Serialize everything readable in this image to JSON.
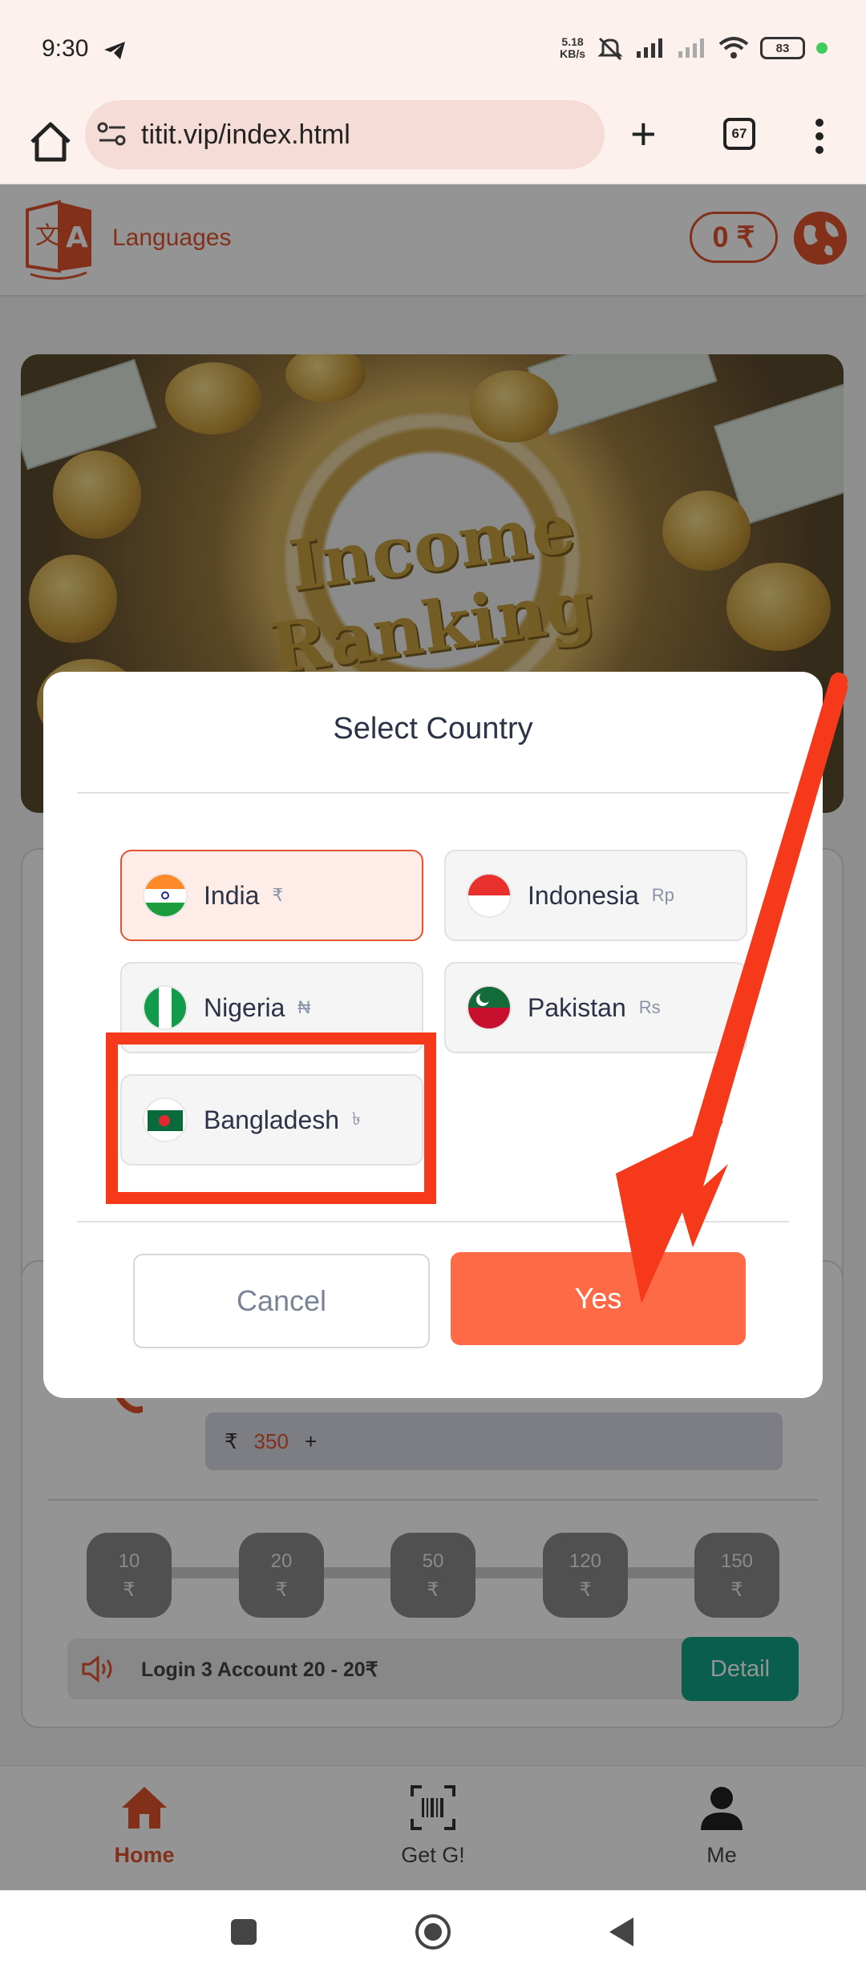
{
  "status_bar": {
    "time": "9:30",
    "net_speed_value": "5.18",
    "net_speed_unit": "KB/s",
    "battery": "83"
  },
  "browser": {
    "url": "titit.vip/index.html",
    "tab_count": "67"
  },
  "header": {
    "languages_label": "Languages",
    "balance": "0 ₹"
  },
  "banner": {
    "line1": "Income",
    "line2": "Ranking"
  },
  "background": {
    "amount_currency": "₹",
    "amount_value": "350",
    "amount_plus": "+",
    "reward_chips": [
      {
        "value": "10",
        "currency": "₹"
      },
      {
        "value": "20",
        "currency": "₹"
      },
      {
        "value": "50",
        "currency": "₹"
      },
      {
        "value": "120",
        "currency": "₹"
      },
      {
        "value": "150",
        "currency": "₹"
      }
    ],
    "notice_text": "Login 3 Account 20 - 20₹",
    "detail_label": "Detail"
  },
  "bottom_nav": {
    "home": "Home",
    "get": "Get G!",
    "me": "Me"
  },
  "dialog": {
    "title": "Select Country",
    "countries": [
      {
        "name": "India",
        "symbol": "₹",
        "selected": true
      },
      {
        "name": "Indonesia",
        "symbol": "Rp"
      },
      {
        "name": "Nigeria",
        "symbol": "₦"
      },
      {
        "name": "Pakistan",
        "symbol": "Rs"
      },
      {
        "name": "Bangladesh",
        "symbol": "৳"
      }
    ],
    "cancel_label": "Cancel",
    "yes_label": "Yes"
  },
  "colors": {
    "accent": "#e2542f",
    "yes_button": "#fe6a46",
    "annotation_red": "#f5391a",
    "detail_green": "#12a386"
  }
}
